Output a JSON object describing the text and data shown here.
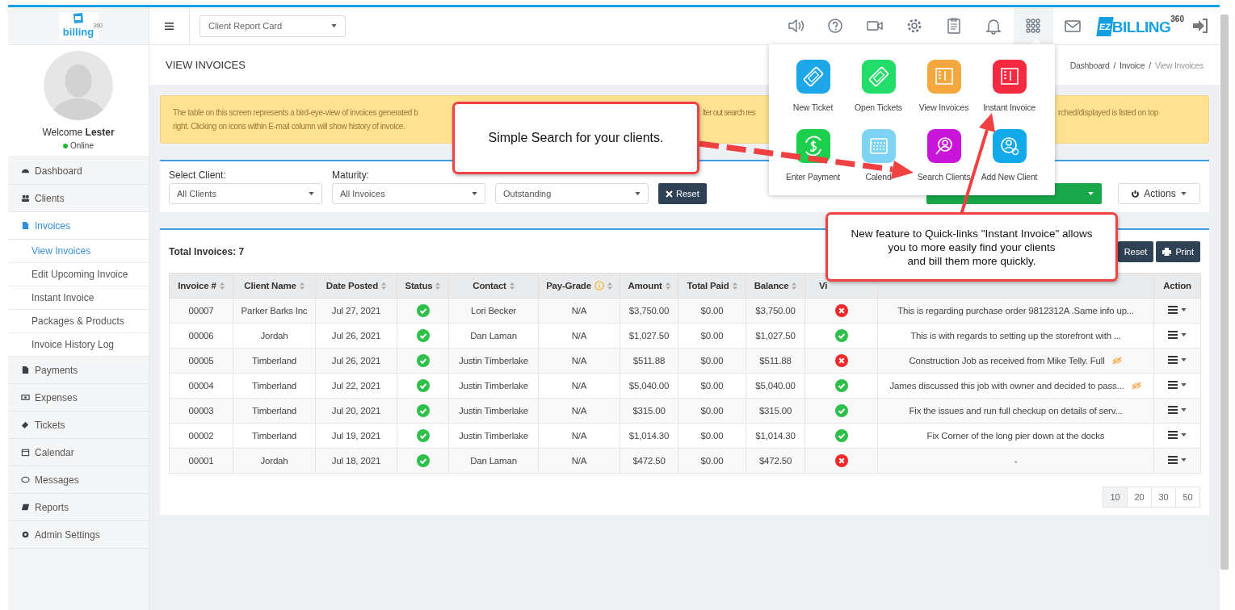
{
  "sidebar": {
    "logo": {
      "name": "billing",
      "edition": "360"
    },
    "user": {
      "greeting": "Welcome",
      "name": "Lester",
      "status": "Online"
    },
    "nav": [
      {
        "label": "Dashboard",
        "kind": "dashboard",
        "selected": false
      },
      {
        "label": "Clients",
        "kind": "clients",
        "selected": false
      },
      {
        "label": "Invoices",
        "kind": "invoices",
        "selected": true,
        "children": [
          {
            "label": "View Invoices",
            "selected": true
          },
          {
            "label": "Edit Upcoming Invoice",
            "selected": false
          },
          {
            "label": "Instant Invoice",
            "selected": false
          },
          {
            "label": "Packages & Products",
            "selected": false
          },
          {
            "label": "Invoice History Log",
            "selected": false
          }
        ]
      },
      {
        "label": "Payments",
        "kind": "payments",
        "selected": false
      },
      {
        "label": "Expenses",
        "kind": "expenses",
        "selected": false
      },
      {
        "label": "Tickets",
        "kind": "tickets",
        "selected": false
      },
      {
        "label": "Calendar",
        "kind": "calendar",
        "selected": false
      },
      {
        "label": "Messages",
        "kind": "messages",
        "selected": false
      },
      {
        "label": "Reports",
        "kind": "reports",
        "selected": false
      },
      {
        "label": "Admin Settings",
        "kind": "settings",
        "selected": false
      }
    ]
  },
  "header": {
    "report_select": "Client Report Card",
    "toolbar": [
      {
        "kind": "sound",
        "selected": false
      },
      {
        "kind": "help",
        "selected": false
      },
      {
        "kind": "video",
        "selected": false
      },
      {
        "kind": "settings",
        "selected": false
      },
      {
        "kind": "clipboard",
        "selected": false
      },
      {
        "kind": "bell",
        "selected": false
      },
      {
        "kind": "apps",
        "selected": true
      },
      {
        "kind": "mail",
        "selected": false
      }
    ],
    "brand": {
      "badge": "EZ",
      "name": "BILLING",
      "edition": "360"
    }
  },
  "page": {
    "title": "VIEW INVOICES",
    "breadcrumb": [
      {
        "label": "Dashboard",
        "current": false
      },
      {
        "label": "Invoice",
        "current": false
      },
      {
        "label": "View Invoices",
        "current": true
      }
    ],
    "separator": "/"
  },
  "alert": {
    "line_1": [
      "The table on this screen represents a bird-eye-view of invoices generated b",
      "lter out search res",
      "rched/displayed is listed on top"
    ],
    "line_2": "right. Clicking on icons within E-mail column will show history of invoice."
  },
  "filters": [
    {
      "label": "Select Client:",
      "value": "All Clients"
    },
    {
      "label": "Maturity:",
      "value": "All Invoices"
    },
    {
      "value": "Outstanding"
    }
  ],
  "reset_button": "Reset",
  "actions_button": "Actions",
  "table": {
    "total": "Total Invoices: 7",
    "buttons": [
      {
        "label": "Reset",
        "kind": "reset"
      },
      {
        "label": "Print",
        "kind": "print"
      }
    ],
    "columns": [
      {
        "label": "Invoice #",
        "sortable": true,
        "info": false
      },
      {
        "label": "Client Name",
        "sortable": true,
        "info": false
      },
      {
        "label": "Date Posted",
        "sortable": true,
        "info": false
      },
      {
        "label": "Status",
        "sortable": true,
        "info": false
      },
      {
        "label": "Contact",
        "sortable": true,
        "info": false
      },
      {
        "label": "Pay-Grade",
        "sortable": true,
        "info": true
      },
      {
        "label": "Amount",
        "sortable": true,
        "info": false
      },
      {
        "label": "Total Paid",
        "sortable": true,
        "info": false
      },
      {
        "label": "Balance",
        "sortable": true,
        "info": false
      },
      {
        "label": "Vi",
        "sortable": false,
        "info": false
      },
      {
        "sortable": false,
        "info": false
      },
      {
        "label": "Action",
        "sortable": false,
        "info": false
      }
    ],
    "rows": [
      {
        "invoice": "00007",
        "client": "Parker Barks Inc",
        "date": "Jul 27, 2021",
        "paid": true,
        "contact": "Lori Becker",
        "pay_grade": "N/A",
        "amount": "$3,750.00",
        "total_paid": "$0.00",
        "balance": "$3,750.00",
        "viewed": false,
        "notes": "This is regarding purchase order 9812312A .Same info up...",
        "hidden_note": false
      },
      {
        "invoice": "00006",
        "client": "Jordah",
        "date": "Jul 26, 2021",
        "paid": true,
        "contact": "Dan Laman",
        "pay_grade": "N/A",
        "amount": "$1,027.50",
        "total_paid": "$0.00",
        "balance": "$1,027.50",
        "viewed": true,
        "notes": "This is with regards to setting up the storefront with ...",
        "hidden_note": false
      },
      {
        "invoice": "00005",
        "client": "Timberland",
        "date": "Jul 26, 2021",
        "paid": true,
        "contact": "Justin Timberlake",
        "pay_grade": "N/A",
        "amount": "$511.88",
        "total_paid": "$0.00",
        "balance": "$511.88",
        "viewed": false,
        "notes": "Construction Job as received from Mike Telly. Full",
        "hidden_note": true
      },
      {
        "invoice": "00004",
        "client": "Timberland",
        "date": "Jul 22, 2021",
        "paid": true,
        "contact": "Justin Timberlake",
        "pay_grade": "N/A",
        "amount": "$5,040.00",
        "total_paid": "$0.00",
        "balance": "$5,040.00",
        "viewed": true,
        "notes": "James discussed this job with owner and decided to pass...",
        "hidden_note": true
      },
      {
        "invoice": "00003",
        "client": "Timberland",
        "date": "Jul 20, 2021",
        "paid": true,
        "contact": "Justin Timberlake",
        "pay_grade": "N/A",
        "amount": "$315.00",
        "total_paid": "$0.00",
        "balance": "$315.00",
        "viewed": true,
        "notes": "Fix the issues and run full checkup on details of serv...",
        "hidden_note": false
      },
      {
        "invoice": "00002",
        "client": "Timberland",
        "date": "Jul 19, 2021",
        "paid": true,
        "contact": "Justin Timberlake",
        "pay_grade": "N/A",
        "amount": "$1,014.30",
        "total_paid": "$0.00",
        "balance": "$1,014.30",
        "viewed": true,
        "notes": "Fix Corner of the long pier down at the docks",
        "hidden_note": false
      },
      {
        "invoice": "00001",
        "client": "Jordah",
        "date": "Jul 18, 2021",
        "paid": true,
        "contact": "Dan Laman",
        "pay_grade": "N/A",
        "amount": "$472.50",
        "total_paid": "$0.00",
        "balance": "$472.50",
        "viewed": false,
        "notes": "-",
        "hidden_note": false
      }
    ]
  },
  "pagination": [
    {
      "label": "10",
      "selected": true
    },
    {
      "label": "20",
      "selected": false
    },
    {
      "label": "30",
      "selected": false
    },
    {
      "label": "50",
      "selected": false
    }
  ],
  "quick_menu": [
    {
      "label": "New Ticket",
      "kind": "ticket",
      "color": "#1ea7e8"
    },
    {
      "label": "Open Tickets",
      "kind": "ticket",
      "color": "#22dd6a"
    },
    {
      "label": "View Invoices",
      "kind": "invoice",
      "color": "#f4a73c"
    },
    {
      "label": "Instant Invoice",
      "kind": "invoice",
      "color": "#f5293f"
    },
    {
      "label": "Enter Payment",
      "kind": "payment",
      "color": "#1ccf4c"
    },
    {
      "label": "Calend",
      "kind": "calendar",
      "color": "#7fd3f5"
    },
    {
      "label": "Search Clients",
      "kind": "search-user",
      "color": "#c815d9"
    },
    {
      "label": "Add New Client",
      "kind": "add-user",
      "color": "#12a9ea"
    }
  ],
  "callouts": [
    {
      "text": "Simple Search for your clients."
    },
    {
      "text": "New feature to Quick-links \"Instant Invoice\" allows\nyou to more easily find your clients\nand bill them more quickly."
    }
  ]
}
